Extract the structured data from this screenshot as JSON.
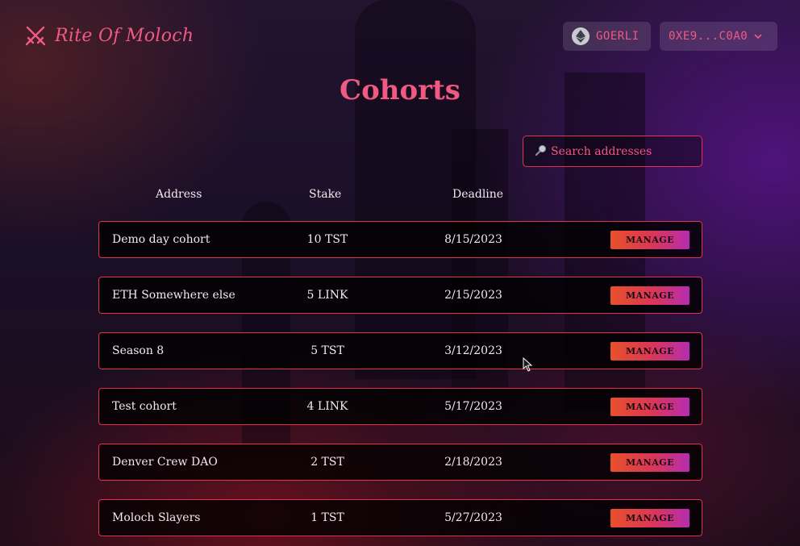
{
  "brand": {
    "name": "Rite Of Moloch",
    "logo_icon": "crossed-swords-icon"
  },
  "network": {
    "label": "GOERLI",
    "icon": "ethereum-icon"
  },
  "account": {
    "label": "0XE9...C0A0",
    "icon": "chevron-down-icon"
  },
  "page": {
    "title": "Cohorts"
  },
  "search": {
    "placeholder": "Search addresses",
    "value": "",
    "icon": "magnifier-icon"
  },
  "table": {
    "columns": [
      "Address",
      "Stake",
      "Deadline"
    ],
    "rows": [
      {
        "address": "Demo day cohort",
        "stake": "10 TST",
        "deadline": "8/15/2023",
        "action": "MANAGE"
      },
      {
        "address": "ETH Somewhere else",
        "stake": "5 LINK",
        "deadline": "2/15/2023",
        "action": "MANAGE"
      },
      {
        "address": "Season 8",
        "stake": "5 TST",
        "deadline": "3/12/2023",
        "action": "MANAGE"
      },
      {
        "address": "Test cohort",
        "stake": "4 LINK",
        "deadline": "5/17/2023",
        "action": "MANAGE"
      },
      {
        "address": "Denver Crew DAO",
        "stake": "2 TST",
        "deadline": "2/18/2023",
        "action": "MANAGE"
      },
      {
        "address": "Moloch Slayers",
        "stake": "1 TST",
        "deadline": "5/27/2023",
        "action": "MANAGE"
      }
    ]
  },
  "colors": {
    "accent": "#f05a82",
    "border": "#e0314e",
    "button_start": "#e8502a",
    "button_end": "#b52db0"
  }
}
